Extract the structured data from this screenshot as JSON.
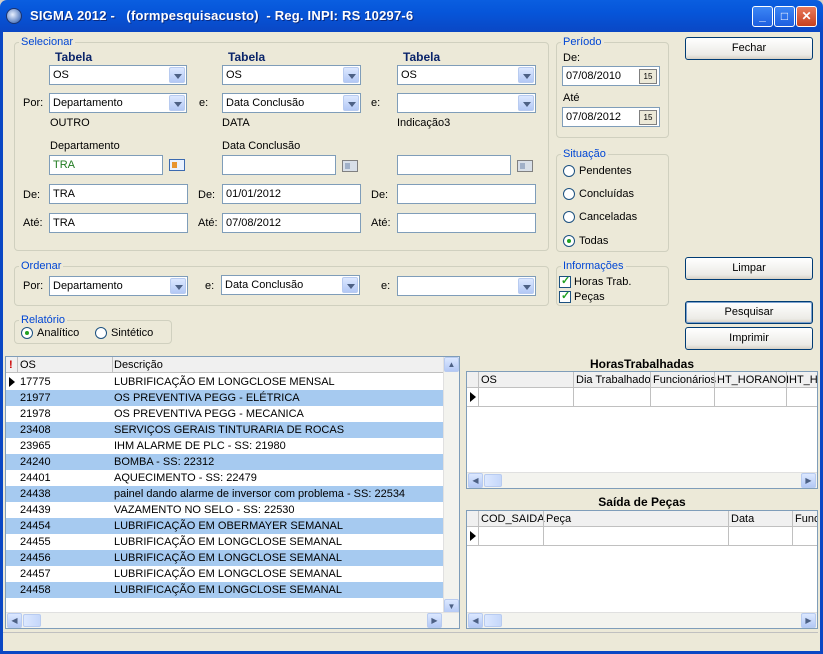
{
  "window": {
    "title": "SIGMA 2012 -   (formpesquisacusto)  - Reg. INPI: RS 10297-6",
    "minimize": "_",
    "maximize": "□",
    "close": "✕"
  },
  "selecionar": {
    "legend": "Selecionar",
    "tabela_label": "Tabela",
    "por_label": "Por:",
    "e_label": "e:",
    "de_label": "De:",
    "ate_label": "Até:",
    "col1": {
      "tabela": "OS",
      "campo": "Departamento",
      "caption": "OUTRO",
      "field_label": "Departamento",
      "field_value": "TRA",
      "de": "TRA",
      "ate": "TRA"
    },
    "col2": {
      "tabela": "OS",
      "campo": "Data Conclusão",
      "caption": "DATA",
      "field_label": "Data Conclusão",
      "field_value": "",
      "de": "01/01/2012",
      "ate": "07/08/2012"
    },
    "col3": {
      "tabela": "OS",
      "campo": "",
      "caption": "Indicação3",
      "field_value": "",
      "de": "",
      "ate": ""
    }
  },
  "periodo": {
    "legend": "Período",
    "de_label": "De:",
    "de": "07/08/2010",
    "ate_label": "Até",
    "ate": "07/08/2012",
    "cal_icon": "15"
  },
  "situacao": {
    "legend": "Situação",
    "options": [
      "Pendentes",
      "Concluídas",
      "Canceladas",
      "Todas"
    ],
    "selected": "Todas"
  },
  "ordenar": {
    "legend": "Ordenar",
    "por_label": "Por:",
    "e_label": "e:",
    "campo1": "Departamento",
    "campo2": "Data Conclusão",
    "campo3": ""
  },
  "informacoes": {
    "legend": "Informações",
    "horas": "Horas Trab.",
    "pecas": "Peças"
  },
  "relatorio": {
    "legend": "Relatório",
    "analitico": "Analítico",
    "sintetico": "Sintético",
    "selected": "Analítico"
  },
  "buttons": {
    "fechar": "Fechar",
    "limpar": "Limpar",
    "pesquisar": "Pesquisar",
    "imprimir": "Imprimir"
  },
  "os_grid": {
    "headers": [
      "OS",
      "Descrição"
    ],
    "flag": "!",
    "rows": [
      {
        "os": "17775",
        "desc": "LUBRIFICAÇÃO EM LONGCLOSE MENSAL"
      },
      {
        "os": "21977",
        "desc": "OS PREVENTIVA PEGG  - ELÉTRICA"
      },
      {
        "os": "21978",
        "desc": "OS PREVENTIVA PEGG  - MECANICA"
      },
      {
        "os": "23408",
        "desc": "SERVIÇOS GERAIS TINTURARIA DE ROCAS"
      },
      {
        "os": "23965",
        "desc": "IHM ALARME DE PLC - SS: 21980"
      },
      {
        "os": "24240",
        "desc": "BOMBA - SS: 22312"
      },
      {
        "os": "24401",
        "desc": "AQUECIMENTO - SS: 22479"
      },
      {
        "os": "24438",
        "desc": "painel dando alarme de inversor com problema - SS: 22534"
      },
      {
        "os": "24439",
        "desc": "VAZAMENTO NO SELO - SS: 22530"
      },
      {
        "os": "24454",
        "desc": "LUBRIFICAÇÃO EM OBERMAYER SEMANAL"
      },
      {
        "os": "24455",
        "desc": "LUBRIFICAÇÃO EM LONGCLOSE SEMANAL"
      },
      {
        "os": "24456",
        "desc": "LUBRIFICAÇÃO EM LONGCLOSE SEMANAL"
      },
      {
        "os": "24457",
        "desc": "LUBRIFICAÇÃO EM LONGCLOSE SEMANAL"
      },
      {
        "os": "24458",
        "desc": "LUBRIFICAÇÃO EM LONGCLOSE SEMANAL"
      }
    ]
  },
  "horas_grid": {
    "title": "HorasTrabalhadas",
    "headers": [
      "OS",
      "Dia Trabalhado",
      "Funcionários",
      "HT_HORANOI",
      "HT_H"
    ]
  },
  "pecas_grid": {
    "title": "Saída de Peças",
    "headers": [
      "COD_SAIDA",
      "Peça",
      "Data",
      "Func"
    ]
  }
}
